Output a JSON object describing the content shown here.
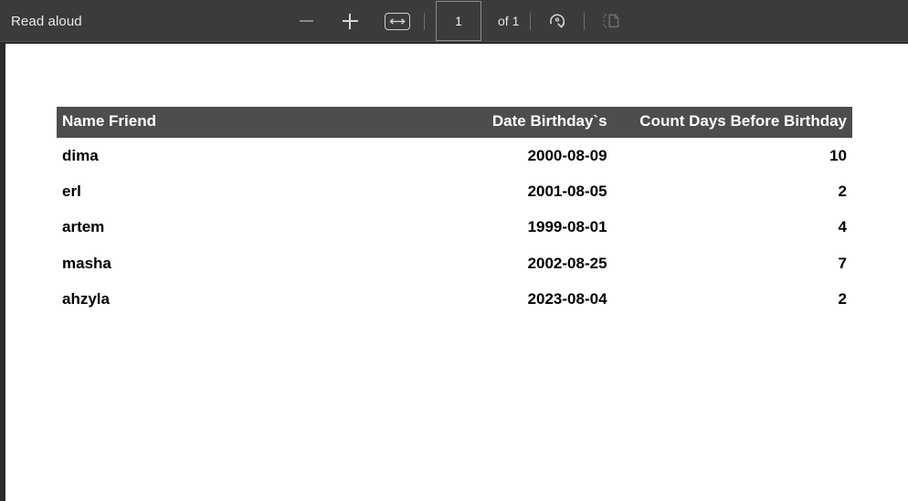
{
  "toolbar": {
    "read_aloud_label": "Read aloud",
    "zoom_out_icon": "minus-icon",
    "zoom_in_icon": "plus-icon",
    "fit_width_icon": "fit-to-width-icon",
    "page_number_value": "1",
    "page_number_placeholder": "1",
    "page_total_label": "of 1",
    "rotate_icon": "rotate-clockwise-icon",
    "page_view_icon": "page-view-icon",
    "colors": {
      "background": "#3b3b3b",
      "text": "#eaeaea",
      "icon_enabled": "#d6d6d6",
      "icon_disabled": "#707070",
      "separator": "#6f6f6f",
      "input_border": "#8c8c8c"
    }
  },
  "document": {
    "page_background": "#ffffff",
    "table": {
      "header_background": "#4d4d4d",
      "header_text_color": "#ffffff",
      "body_text_color": "#000000",
      "columns": [
        {
          "label": "Name Friend",
          "align": "left"
        },
        {
          "label": "Date Birthday`s",
          "align": "right"
        },
        {
          "label": "Count Days Before Birthday",
          "align": "right"
        }
      ],
      "rows": [
        {
          "name": "dima",
          "date": "2000-08-09",
          "count": "10"
        },
        {
          "name": "erl",
          "date": "2001-08-05",
          "count": "2"
        },
        {
          "name": "artem",
          "date": "1999-08-01",
          "count": "4"
        },
        {
          "name": "masha",
          "date": "2002-08-25",
          "count": "7"
        },
        {
          "name": "ahzyla",
          "date": "2023-08-04",
          "count": "2"
        }
      ]
    }
  }
}
